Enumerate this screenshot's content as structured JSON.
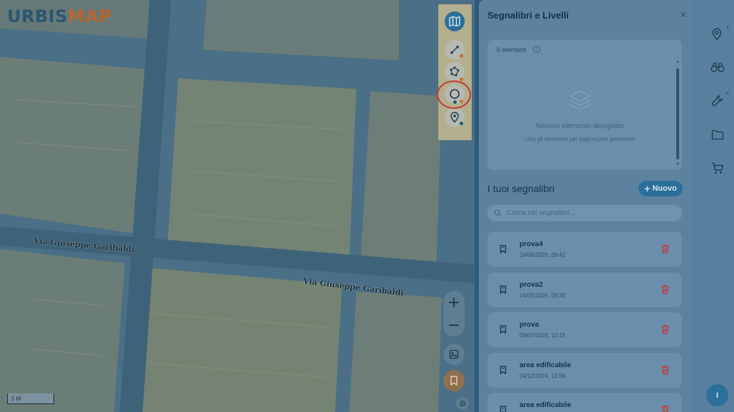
{
  "map": {
    "logo_a": "URBIS",
    "logo_b": "MAP",
    "street_1": "Via Giuseppe Garibaldi",
    "street_2": "Via Giuseppe Garibaldi",
    "scale_label": "5 M",
    "zoom_in": "+",
    "zoom_out": "−",
    "toolbar_icons": [
      "map-icon",
      "line-tool-icon",
      "polygon-tool-icon",
      "circle-tool-icon",
      "marker-tool-icon"
    ],
    "controls_icons": [
      "basemap-image-icon",
      "bookmark-icon",
      "location-icon"
    ]
  },
  "panel": {
    "title": "Segnalibri e Livelli",
    "close": "×",
    "layers": {
      "count": "0 elementi",
      "info": "i",
      "empty_title": "Nessun elemento disegnato.",
      "empty_subtitle": "Usa gli strumenti per aggiungere geometrie."
    },
    "bookmarks_title": "I tuoi segnalibri",
    "new_button": "Nuovo",
    "new_plus": "+",
    "search_placeholder": "Cerca nei segnalibri...",
    "bookmarks": [
      {
        "name": "prova4",
        "date": "14/05/2026, 09:42"
      },
      {
        "name": "prova2",
        "date": "14/05/2026, 09:30"
      },
      {
        "name": "prova",
        "date": "09/07/2025, 10:15"
      },
      {
        "name": "area edificabile",
        "date": "04/12/2024, 12:06"
      },
      {
        "name": "area edificabile",
        "date": ""
      }
    ]
  },
  "strip": {
    "icons": [
      "location-pin-icon",
      "binoculars-icon",
      "wrench-icon",
      "folder-icon",
      "cart-icon"
    ],
    "avatar": "I"
  },
  "colors": {
    "accent": "#2b6f9a",
    "logo_orange": "#b8662f",
    "delete_red": "#c43a3a",
    "panel_bg": "#5c82a0"
  }
}
